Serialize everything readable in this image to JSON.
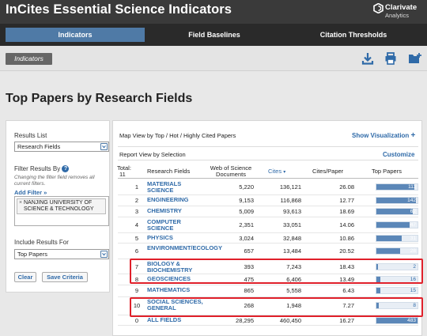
{
  "app": {
    "title": "InCites Essential Science Indicators",
    "brand_name": "Clarivate",
    "brand_sub": "Analytics"
  },
  "tabs": [
    {
      "label": "Indicators",
      "active": true
    },
    {
      "label": "Field Baselines",
      "active": false
    },
    {
      "label": "Citation Thresholds",
      "active": false
    }
  ],
  "subbar": {
    "button_label": "Indicators",
    "tools": [
      "download-icon",
      "print-icon",
      "add-folder-icon"
    ]
  },
  "page": {
    "title": "Top Papers by Research Fields"
  },
  "sidebar": {
    "results_list_label": "Results List",
    "results_list_value": "Research Fields",
    "filter_label": "Filter Results By",
    "filter_hint": "Changing the filter field removes all current filters.",
    "add_filter": "Add Filter »",
    "filter_chip": "NANJING UNIVERSITY OF SCIENCE & TECHNOLOGY",
    "include_label": "Include Results For",
    "include_value": "Top Papers",
    "clear_label": "Clear",
    "save_label": "Save Criteria"
  },
  "main": {
    "map_view": "Map View by Top / Hot / Highly Cited Papers",
    "show_viz": "Show Visualization",
    "report_view": "Report View by Selection",
    "customize": "Customize"
  },
  "table": {
    "headers": {
      "total": "Total:",
      "total_count": "11",
      "field": "Research Fields",
      "docs_1": "Web of Science",
      "docs_2": "Documents",
      "cites": "Cites",
      "cpp": "Cites/Paper",
      "top": "Top Papers"
    },
    "rows": [
      {
        "rank": "1",
        "field": "MATERIALS SCIENCE",
        "docs": "5,220",
        "cites": "136,121",
        "cpp": "26.08",
        "top": "111",
        "top_pct": 0.92
      },
      {
        "rank": "2",
        "field": "ENGINEERING",
        "docs": "9,153",
        "cites": "116,868",
        "cpp": "12.77",
        "top": "142",
        "top_pct": 0.97
      },
      {
        "rank": "3",
        "field": "CHEMISTRY",
        "docs": "5,009",
        "cites": "93,613",
        "cpp": "18.69",
        "top": "62",
        "top_pct": 0.88
      },
      {
        "rank": "4",
        "field": "COMPUTER SCIENCE",
        "docs": "2,351",
        "cites": "33,051",
        "cpp": "14.06",
        "top": "47",
        "top_pct": 0.8
      },
      {
        "rank": "5",
        "field": "PHYSICS",
        "docs": "3,024",
        "cites": "32,848",
        "cpp": "10.86",
        "top": "31",
        "top_pct": 0.62
      },
      {
        "rank": "6",
        "field": "ENVIRONMENT/ECOLOGY",
        "docs": "657",
        "cites": "13,484",
        "cpp": "20.52",
        "top": "28",
        "top_pct": 0.58
      },
      {
        "rank": "7",
        "field": "BIOLOGY & BIOCHEMISTRY",
        "docs": "393",
        "cites": "7,243",
        "cpp": "18.43",
        "top": "2",
        "top_pct": 0.03
      },
      {
        "rank": "8",
        "field": "GEOSCIENCES",
        "docs": "475",
        "cites": "6,406",
        "cpp": "13.49",
        "top": "16",
        "top_pct": 0.1
      },
      {
        "rank": "9",
        "field": "MATHEMATICS",
        "docs": "865",
        "cites": "5,558",
        "cpp": "6.43",
        "top": "15",
        "top_pct": 0.1
      },
      {
        "rank": "10",
        "field": "SOCIAL SCIENCES, GENERAL",
        "docs": "268",
        "cites": "1,948",
        "cpp": "7.27",
        "top": "8",
        "top_pct": 0.05
      },
      {
        "rank": "0",
        "field": "ALL FIELDS",
        "docs": "28,295",
        "cites": "460,450",
        "cpp": "16.27",
        "top": "483",
        "top_pct": 1.0
      }
    ]
  },
  "colors": {
    "accent": "#4f7aa6",
    "link": "#2f6aa8",
    "highlight": "#e0202a"
  }
}
